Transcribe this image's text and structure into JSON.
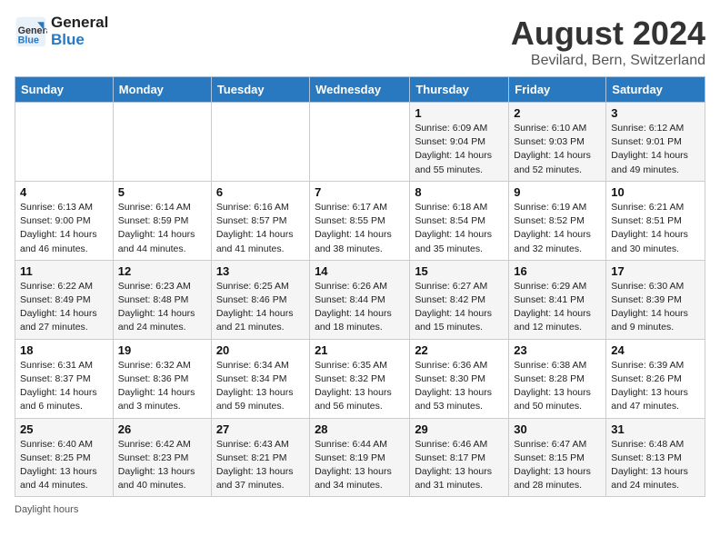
{
  "header": {
    "logo_line1": "General",
    "logo_line2": "Blue",
    "month": "August 2024",
    "location": "Bevilard, Bern, Switzerland"
  },
  "weekdays": [
    "Sunday",
    "Monday",
    "Tuesday",
    "Wednesday",
    "Thursday",
    "Friday",
    "Saturday"
  ],
  "weeks": [
    [
      {
        "day": "",
        "info": ""
      },
      {
        "day": "",
        "info": ""
      },
      {
        "day": "",
        "info": ""
      },
      {
        "day": "",
        "info": ""
      },
      {
        "day": "1",
        "info": "Sunrise: 6:09 AM\nSunset: 9:04 PM\nDaylight: 14 hours and 55 minutes."
      },
      {
        "day": "2",
        "info": "Sunrise: 6:10 AM\nSunset: 9:03 PM\nDaylight: 14 hours and 52 minutes."
      },
      {
        "day": "3",
        "info": "Sunrise: 6:12 AM\nSunset: 9:01 PM\nDaylight: 14 hours and 49 minutes."
      }
    ],
    [
      {
        "day": "4",
        "info": "Sunrise: 6:13 AM\nSunset: 9:00 PM\nDaylight: 14 hours and 46 minutes."
      },
      {
        "day": "5",
        "info": "Sunrise: 6:14 AM\nSunset: 8:59 PM\nDaylight: 14 hours and 44 minutes."
      },
      {
        "day": "6",
        "info": "Sunrise: 6:16 AM\nSunset: 8:57 PM\nDaylight: 14 hours and 41 minutes."
      },
      {
        "day": "7",
        "info": "Sunrise: 6:17 AM\nSunset: 8:55 PM\nDaylight: 14 hours and 38 minutes."
      },
      {
        "day": "8",
        "info": "Sunrise: 6:18 AM\nSunset: 8:54 PM\nDaylight: 14 hours and 35 minutes."
      },
      {
        "day": "9",
        "info": "Sunrise: 6:19 AM\nSunset: 8:52 PM\nDaylight: 14 hours and 32 minutes."
      },
      {
        "day": "10",
        "info": "Sunrise: 6:21 AM\nSunset: 8:51 PM\nDaylight: 14 hours and 30 minutes."
      }
    ],
    [
      {
        "day": "11",
        "info": "Sunrise: 6:22 AM\nSunset: 8:49 PM\nDaylight: 14 hours and 27 minutes."
      },
      {
        "day": "12",
        "info": "Sunrise: 6:23 AM\nSunset: 8:48 PM\nDaylight: 14 hours and 24 minutes."
      },
      {
        "day": "13",
        "info": "Sunrise: 6:25 AM\nSunset: 8:46 PM\nDaylight: 14 hours and 21 minutes."
      },
      {
        "day": "14",
        "info": "Sunrise: 6:26 AM\nSunset: 8:44 PM\nDaylight: 14 hours and 18 minutes."
      },
      {
        "day": "15",
        "info": "Sunrise: 6:27 AM\nSunset: 8:42 PM\nDaylight: 14 hours and 15 minutes."
      },
      {
        "day": "16",
        "info": "Sunrise: 6:29 AM\nSunset: 8:41 PM\nDaylight: 14 hours and 12 minutes."
      },
      {
        "day": "17",
        "info": "Sunrise: 6:30 AM\nSunset: 8:39 PM\nDaylight: 14 hours and 9 minutes."
      }
    ],
    [
      {
        "day": "18",
        "info": "Sunrise: 6:31 AM\nSunset: 8:37 PM\nDaylight: 14 hours and 6 minutes."
      },
      {
        "day": "19",
        "info": "Sunrise: 6:32 AM\nSunset: 8:36 PM\nDaylight: 14 hours and 3 minutes."
      },
      {
        "day": "20",
        "info": "Sunrise: 6:34 AM\nSunset: 8:34 PM\nDaylight: 13 hours and 59 minutes."
      },
      {
        "day": "21",
        "info": "Sunrise: 6:35 AM\nSunset: 8:32 PM\nDaylight: 13 hours and 56 minutes."
      },
      {
        "day": "22",
        "info": "Sunrise: 6:36 AM\nSunset: 8:30 PM\nDaylight: 13 hours and 53 minutes."
      },
      {
        "day": "23",
        "info": "Sunrise: 6:38 AM\nSunset: 8:28 PM\nDaylight: 13 hours and 50 minutes."
      },
      {
        "day": "24",
        "info": "Sunrise: 6:39 AM\nSunset: 8:26 PM\nDaylight: 13 hours and 47 minutes."
      }
    ],
    [
      {
        "day": "25",
        "info": "Sunrise: 6:40 AM\nSunset: 8:25 PM\nDaylight: 13 hours and 44 minutes."
      },
      {
        "day": "26",
        "info": "Sunrise: 6:42 AM\nSunset: 8:23 PM\nDaylight: 13 hours and 40 minutes."
      },
      {
        "day": "27",
        "info": "Sunrise: 6:43 AM\nSunset: 8:21 PM\nDaylight: 13 hours and 37 minutes."
      },
      {
        "day": "28",
        "info": "Sunrise: 6:44 AM\nSunset: 8:19 PM\nDaylight: 13 hours and 34 minutes."
      },
      {
        "day": "29",
        "info": "Sunrise: 6:46 AM\nSunset: 8:17 PM\nDaylight: 13 hours and 31 minutes."
      },
      {
        "day": "30",
        "info": "Sunrise: 6:47 AM\nSunset: 8:15 PM\nDaylight: 13 hours and 28 minutes."
      },
      {
        "day": "31",
        "info": "Sunrise: 6:48 AM\nSunset: 8:13 PM\nDaylight: 13 hours and 24 minutes."
      }
    ]
  ],
  "footer": "Daylight hours"
}
